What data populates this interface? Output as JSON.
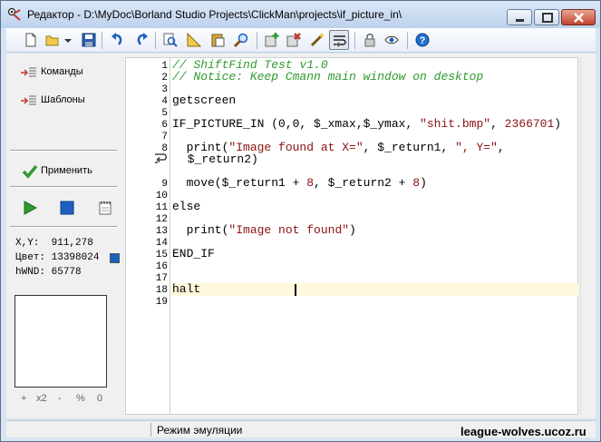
{
  "window": {
    "title": "Редактор - D:\\MyDoc\\Borland Studio Projects\\ClickMan\\projects\\if_picture_in\\"
  },
  "toolbar": {
    "buttons": [
      "new-file",
      "open-folder",
      "open-dropdown",
      "save",
      "undo",
      "redo",
      "find",
      "ruler",
      "paste",
      "search",
      "add-item",
      "delete-item",
      "magic-wand",
      "wrap-toggle",
      "lock",
      "view",
      "help"
    ]
  },
  "sidebar": {
    "items": [
      {
        "label": "Команды"
      },
      {
        "label": "Шаблоны"
      }
    ],
    "apply_label": "Применить"
  },
  "info": {
    "xy_label": "X,Y:",
    "xy_value": "911,278",
    "color_label": "Цвет:",
    "color_value": "13398024",
    "hwnd_label": "hWND:",
    "hwnd_value": "65778",
    "swatch_color": "#1565c0"
  },
  "zoom": {
    "plus": "+",
    "x2": "x2",
    "minus": "-",
    "percent": "%",
    "zero": "0"
  },
  "editor": {
    "line_numbers": [
      "1",
      "2",
      "3",
      "4",
      "5",
      "6",
      "7",
      "8",
      "9",
      "10",
      "11",
      "12",
      "13",
      "14",
      "15",
      "16",
      "17",
      "18",
      "19"
    ],
    "lines": {
      "l1": "// ShiftFind Test v1.0",
      "l2": "// Notice: Keep Cmann main window on desktop",
      "l4": "getscreen",
      "l6a": "IF_PICTURE_IN (0,0, $_xmax,$_ymax, ",
      "l6b": "\"shit.bmp\"",
      "l6c": ", ",
      "l6d": "2366701",
      "l6e": ")",
      "l8a": "  print(",
      "l8b": "\"Image found at X=\"",
      "l8c": ", $_return1, ",
      "l8d": "\", Y=\"",
      "l8e": ",",
      "l8f": " $_return2)",
      "l10a": "  move($_return1 + ",
      "l10b": "8",
      "l10c": ", $_return2 + ",
      "l10d": "8",
      "l10e": ")",
      "l12": "else",
      "l14a": "  print(",
      "l14b": "\"Image not found\"",
      "l14c": ")",
      "l16": "END_IF",
      "l19": "halt"
    }
  },
  "status": {
    "mode": "Режим эмуляции"
  },
  "watermark": "league-wolves.ucoz.ru"
}
